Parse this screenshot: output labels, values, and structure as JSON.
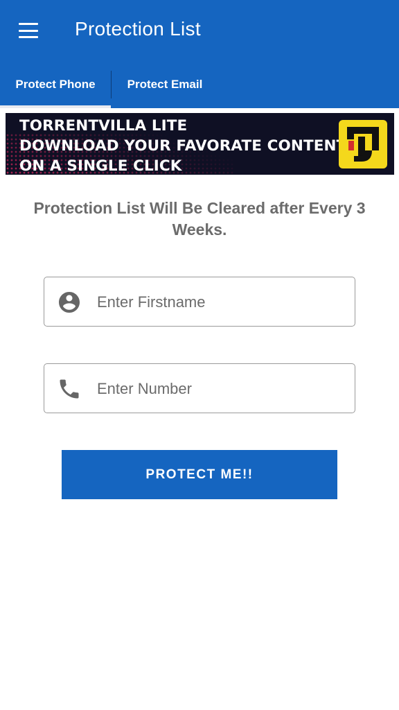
{
  "app": {
    "title": "Protection List",
    "accent_color": "#1565c0"
  },
  "tabs": [
    {
      "label": "Protect Phone",
      "selected": true
    },
    {
      "label": "Protect Email",
      "selected": false
    }
  ],
  "banner": {
    "lines": [
      "TORRENTVILLA LITE",
      "DOWNLOAD YOUR FAVORATE CONTENT",
      "ON A SINGLE CLICK"
    ],
    "logo_icon": "torrentvilla-logo-icon"
  },
  "notice": "Protection List Will Be Cleared after Every 3 Weeks.",
  "form": {
    "firstname": {
      "placeholder": "Enter Firstname",
      "value": "",
      "icon": "account-circle-icon"
    },
    "number": {
      "placeholder": "Enter Number",
      "value": "",
      "icon": "phone-icon"
    },
    "submit_label": "PROTECT ME!!"
  }
}
